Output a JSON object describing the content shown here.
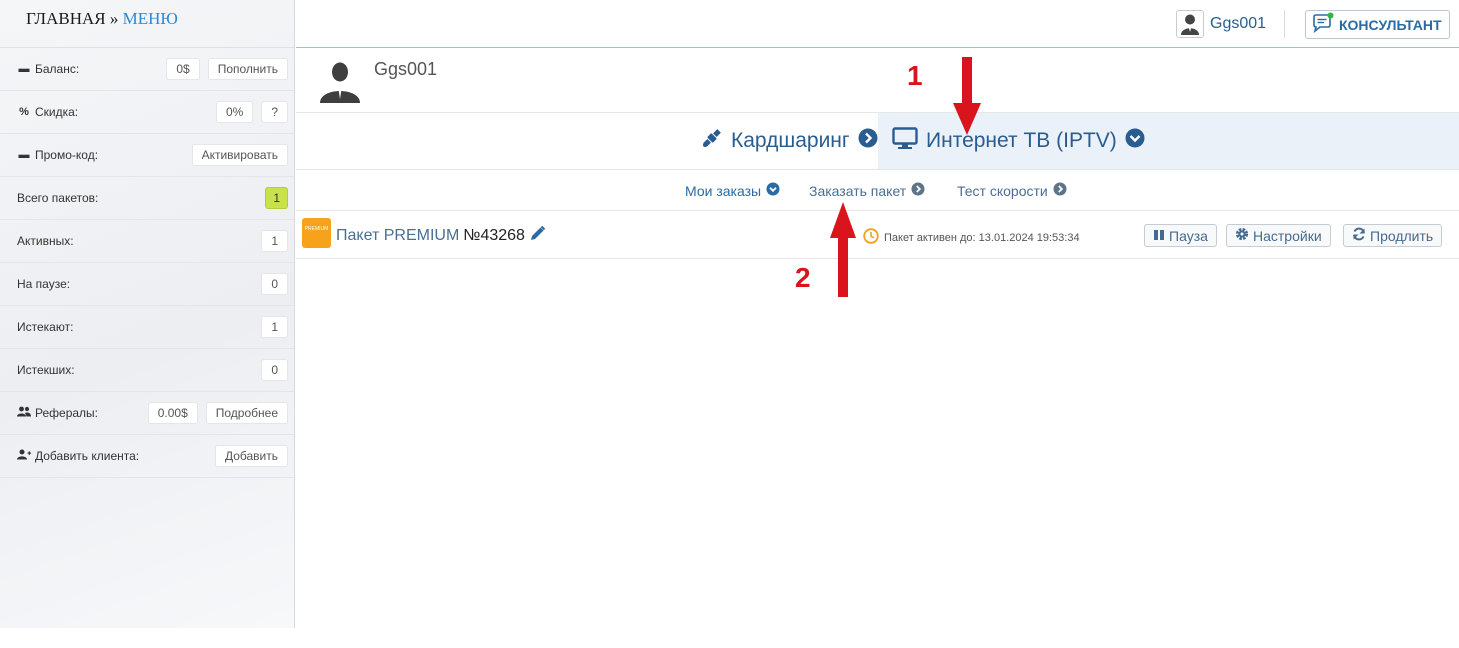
{
  "sidebar": {
    "home": "ГЛАВНАЯ »",
    "menu": "МЕНЮ",
    "rows": {
      "balance": {
        "label": "Баланс:",
        "value": "0$",
        "button": "Пополнить"
      },
      "discount": {
        "label": "Скидка:",
        "value": "0%",
        "button": "?"
      },
      "promo": {
        "label": "Промо-код:",
        "button": "Активировать"
      },
      "total": {
        "label": "Всего пакетов:",
        "value": "1"
      },
      "active": {
        "label": "Активных:",
        "value": "1"
      },
      "paused": {
        "label": "На паузе:",
        "value": "0"
      },
      "expiring": {
        "label": "Истекают:",
        "value": "1"
      },
      "expired": {
        "label": "Истекших:",
        "value": "0"
      },
      "referrals": {
        "label": "Рефералы:",
        "value": "0.00$",
        "button": "Подробнее"
      },
      "add_client": {
        "label": "Добавить клиента:",
        "button": "Добавить"
      }
    }
  },
  "topbar": {
    "username": "Ggs001",
    "consultant": "КОНСУЛЬТАНТ"
  },
  "profile": {
    "name": "Ggs001"
  },
  "tabs": {
    "cardsharing": "Кардшаринг",
    "iptv": "Интернет ТВ (IPTV)"
  },
  "subtabs": {
    "my_orders": "Мои заказы",
    "order_package": "Заказать пакет",
    "speed_test": "Тест скорости"
  },
  "package": {
    "icon_text": "PREMIUM",
    "title": "Пакет PREMIUM",
    "number": "№43268",
    "status": "Пакет активен до: 13.01.2024 19:53:34",
    "pause": "Пауза",
    "settings": "Настройки",
    "extend": "Продлить"
  },
  "annotations": {
    "first": "1",
    "second": "2"
  },
  "colors": {
    "accent": "#2a5d8f",
    "annotation": "#d9141c",
    "badge": "#c9e24a",
    "package": "#f6a21a"
  }
}
